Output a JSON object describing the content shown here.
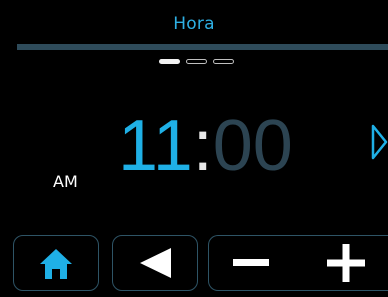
{
  "header": {
    "title": "Hora"
  },
  "pager": {
    "count": 3,
    "active_index": 0
  },
  "time": {
    "hour": "11",
    "separator": ":",
    "minute": "00",
    "period": "AM",
    "editing": "hour"
  },
  "colors": {
    "accent": "#1fb0e6",
    "title": "#2eb0e4",
    "inactive_digits": "#2c4452",
    "divider": "#2e4b5a",
    "button_border": "#2e5466"
  },
  "icons": {
    "home": "home-icon",
    "back": "left-triangle-icon",
    "next": "right-triangle-icon",
    "minus": "minus-icon",
    "plus": "plus-icon"
  }
}
